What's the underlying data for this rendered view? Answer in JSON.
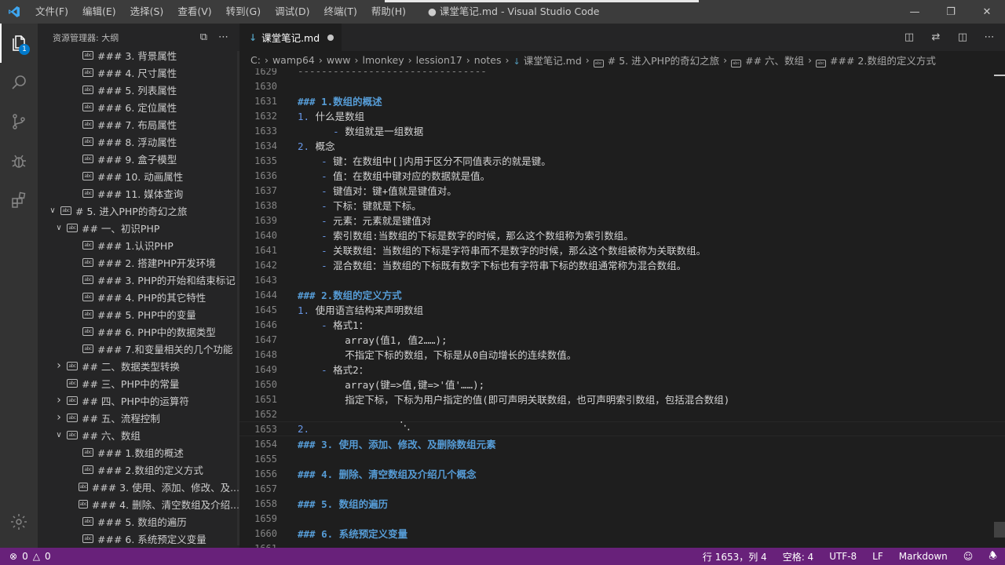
{
  "window": {
    "title": "● 课堂笔记.md - Visual Studio Code",
    "menu": [
      "文件(F)",
      "编辑(E)",
      "选择(S)",
      "查看(V)",
      "转到(G)",
      "调试(D)",
      "终端(T)",
      "帮助(H)"
    ]
  },
  "activity": {
    "explorer_badge": "1"
  },
  "sidebar": {
    "header": "资源管理器: 大纲",
    "items": [
      {
        "indent": 2,
        "twist": "",
        "icon": "symbol",
        "label": "### 3. 背景属性"
      },
      {
        "indent": 2,
        "twist": "",
        "icon": "symbol",
        "label": "### 4. 尺寸属性"
      },
      {
        "indent": 2,
        "twist": "",
        "icon": "symbol",
        "label": "### 5. 列表属性"
      },
      {
        "indent": 2,
        "twist": "",
        "icon": "symbol",
        "label": "### 6. 定位属性"
      },
      {
        "indent": 2,
        "twist": "",
        "icon": "symbol",
        "label": "### 7. 布局属性"
      },
      {
        "indent": 2,
        "twist": "",
        "icon": "symbol",
        "label": "### 8. 浮动属性"
      },
      {
        "indent": 2,
        "twist": "",
        "icon": "symbol",
        "label": "### 9. 盒子模型"
      },
      {
        "indent": 2,
        "twist": "",
        "icon": "symbol",
        "label": "### 10. 动画属性"
      },
      {
        "indent": 2,
        "twist": "",
        "icon": "symbol",
        "label": "### 11. 媒体查询"
      },
      {
        "indent": 0,
        "twist": "open",
        "icon": "symbol",
        "label": "# 5. 进入PHP的奇幻之旅"
      },
      {
        "indent": 1,
        "twist": "open",
        "icon": "symbol",
        "label": "## 一、初识PHP"
      },
      {
        "indent": 2,
        "twist": "",
        "icon": "symbol",
        "label": "### 1.认识PHP"
      },
      {
        "indent": 2,
        "twist": "",
        "icon": "symbol",
        "label": "### 2. 搭建PHP开发环境"
      },
      {
        "indent": 2,
        "twist": "",
        "icon": "symbol",
        "label": "### 3. PHP的开始和结束标记"
      },
      {
        "indent": 2,
        "twist": "",
        "icon": "symbol",
        "label": "### 4. PHP的其它特性"
      },
      {
        "indent": 2,
        "twist": "",
        "icon": "symbol",
        "label": "### 5. PHP中的变量"
      },
      {
        "indent": 2,
        "twist": "",
        "icon": "symbol",
        "label": "### 6. PHP中的数据类型"
      },
      {
        "indent": 2,
        "twist": "",
        "icon": "symbol",
        "label": "### 7.和变量相关的几个功能"
      },
      {
        "indent": 1,
        "twist": "closed",
        "icon": "symbol",
        "label": "## 二、数据类型转换"
      },
      {
        "indent": 1,
        "twist": "",
        "icon": "symbol",
        "label": "## 三、PHP中的常量"
      },
      {
        "indent": 1,
        "twist": "closed",
        "icon": "symbol",
        "label": "## 四、PHP中的运算符"
      },
      {
        "indent": 1,
        "twist": "closed",
        "icon": "symbol",
        "label": "## 五、流程控制"
      },
      {
        "indent": 1,
        "twist": "open",
        "icon": "symbol",
        "label": "## 六、数组"
      },
      {
        "indent": 2,
        "twist": "",
        "icon": "symbol",
        "label": "### 1.数组的概述"
      },
      {
        "indent": 2,
        "twist": "",
        "icon": "symbol",
        "label": "### 2.数组的定义方式"
      },
      {
        "indent": 2,
        "twist": "",
        "icon": "symbol",
        "label": "### 3. 使用、添加、修改、及..."
      },
      {
        "indent": 2,
        "twist": "",
        "icon": "symbol",
        "label": "### 4. 删除、清空数组及介绍..."
      },
      {
        "indent": 2,
        "twist": "",
        "icon": "symbol",
        "label": "### 5. 数组的遍历"
      },
      {
        "indent": 2,
        "twist": "",
        "icon": "symbol",
        "label": "### 6. 系统预定义变量"
      }
    ]
  },
  "tab": {
    "label": "课堂笔记.md"
  },
  "breadcrumb": {
    "parts": [
      "C:",
      "wamp64",
      "www",
      "lmonkey",
      "lession17",
      "notes"
    ],
    "file": "课堂笔记.md",
    "symbols": [
      "# 5. 进入PHP的奇幻之旅",
      "## 六、数组",
      "### 2.数组的定义方式"
    ]
  },
  "editor": {
    "lines": [
      {
        "n": "1629",
        "indent": "",
        "segs": [
          {
            "t": "--------------------------------",
            "c": "dash"
          }
        ]
      },
      {
        "n": "1630",
        "indent": "",
        "segs": []
      },
      {
        "n": "1631",
        "indent": "",
        "segs": [
          {
            "t": "### 1.数组的概述",
            "c": "head"
          }
        ]
      },
      {
        "n": "1632",
        "indent": "",
        "segs": [
          {
            "t": "1. ",
            "c": "list"
          },
          {
            "t": "什么是数组",
            "c": "text"
          }
        ]
      },
      {
        "n": "1633",
        "indent": "      ",
        "segs": [
          {
            "t": "- ",
            "c": "list"
          },
          {
            "t": "数组就是一组数据",
            "c": "text"
          }
        ]
      },
      {
        "n": "1634",
        "indent": "",
        "segs": [
          {
            "t": "2. ",
            "c": "list"
          },
          {
            "t": "概念",
            "c": "text"
          }
        ]
      },
      {
        "n": "1635",
        "indent": "    ",
        "segs": [
          {
            "t": "- ",
            "c": "list"
          },
          {
            "t": "键：在数组中[]内用于区分不同值表示的就是键。",
            "c": "text"
          }
        ]
      },
      {
        "n": "1636",
        "indent": "    ",
        "segs": [
          {
            "t": "- ",
            "c": "list"
          },
          {
            "t": "值：在数组中键对应的数据就是值。",
            "c": "text"
          }
        ]
      },
      {
        "n": "1637",
        "indent": "    ",
        "segs": [
          {
            "t": "- ",
            "c": "list"
          },
          {
            "t": "键值对：键+值就是键值对。",
            "c": "text"
          }
        ]
      },
      {
        "n": "1638",
        "indent": "    ",
        "segs": [
          {
            "t": "- ",
            "c": "list"
          },
          {
            "t": "下标：键就是下标。",
            "c": "text"
          }
        ]
      },
      {
        "n": "1639",
        "indent": "    ",
        "segs": [
          {
            "t": "- ",
            "c": "list"
          },
          {
            "t": "元素：元素就是键值对",
            "c": "text"
          }
        ]
      },
      {
        "n": "1640",
        "indent": "    ",
        "segs": [
          {
            "t": "- ",
            "c": "list"
          },
          {
            "t": "索引数组:当数组的下标是数字的时候，那么这个数组称为索引数组。",
            "c": "text"
          }
        ]
      },
      {
        "n": "1641",
        "indent": "    ",
        "segs": [
          {
            "t": "- ",
            "c": "list"
          },
          {
            "t": "关联数组：当数组的下标是字符串而不是数字的时候，那么这个数组被称为关联数组。",
            "c": "text"
          }
        ]
      },
      {
        "n": "1642",
        "indent": "    ",
        "segs": [
          {
            "t": "- ",
            "c": "list"
          },
          {
            "t": "混合数组：当数组的下标既有数字下标也有字符串下标的数组通常称为混合数组。",
            "c": "text"
          }
        ]
      },
      {
        "n": "1643",
        "indent": "",
        "segs": []
      },
      {
        "n": "1644",
        "indent": "",
        "segs": [
          {
            "t": "### 2.数组的定义方式",
            "c": "head"
          }
        ]
      },
      {
        "n": "1645",
        "indent": "",
        "segs": [
          {
            "t": "1. ",
            "c": "list"
          },
          {
            "t": "使用语言结构来声明数组",
            "c": "text"
          }
        ]
      },
      {
        "n": "1646",
        "indent": "    ",
        "segs": [
          {
            "t": "- ",
            "c": "list"
          },
          {
            "t": "格式1：",
            "c": "text"
          }
        ]
      },
      {
        "n": "1647",
        "indent": "        ",
        "segs": [
          {
            "t": "array(值1, 值2……);",
            "c": "text"
          }
        ]
      },
      {
        "n": "1648",
        "indent": "        ",
        "segs": [
          {
            "t": "不指定下标的数组，下标是从0自动增长的连续数值。",
            "c": "text"
          }
        ]
      },
      {
        "n": "1649",
        "indent": "    ",
        "segs": [
          {
            "t": "- ",
            "c": "list"
          },
          {
            "t": "格式2：",
            "c": "text"
          }
        ]
      },
      {
        "n": "1650",
        "indent": "        ",
        "segs": [
          {
            "t": "array(键=>值,键=>'值'……);",
            "c": "text"
          }
        ]
      },
      {
        "n": "1651",
        "indent": "        ",
        "segs": [
          {
            "t": "指定下标，下标为用户指定的值(即可声明关联数组，也可声明索引数组，包括混合数组)",
            "c": "text"
          }
        ]
      },
      {
        "n": "1652",
        "indent": "",
        "segs": []
      },
      {
        "n": "1653",
        "indent": "",
        "segs": [
          {
            "t": "2. ",
            "c": "list"
          }
        ]
      },
      {
        "n": "1654",
        "indent": "",
        "segs": [
          {
            "t": "### 3. 使用、添加、修改、及删除数组元素",
            "c": "head"
          }
        ]
      },
      {
        "n": "1655",
        "indent": "",
        "segs": []
      },
      {
        "n": "1656",
        "indent": "",
        "segs": [
          {
            "t": "### 4. 删除、清空数组及介绍几个概念",
            "c": "head"
          }
        ]
      },
      {
        "n": "1657",
        "indent": "",
        "segs": []
      },
      {
        "n": "1658",
        "indent": "",
        "segs": [
          {
            "t": "### 5. 数组的遍历",
            "c": "head"
          }
        ]
      },
      {
        "n": "1659",
        "indent": "",
        "segs": []
      },
      {
        "n": "1660",
        "indent": "",
        "segs": [
          {
            "t": "### 6. 系统预定义变量",
            "c": "head"
          }
        ]
      },
      {
        "n": "1661",
        "indent": "",
        "segs": []
      }
    ],
    "current_line": "1653"
  },
  "statusbar": {
    "errors": "0",
    "warnings": "0",
    "position": "行 1653，列 4",
    "spaces": "空格: 4",
    "encoding": "UTF-8",
    "eol": "LF",
    "language": "Markdown"
  },
  "colors": {
    "statusbar": "#68217a",
    "heading": "#569cd6",
    "list_marker": "#6796e6"
  }
}
